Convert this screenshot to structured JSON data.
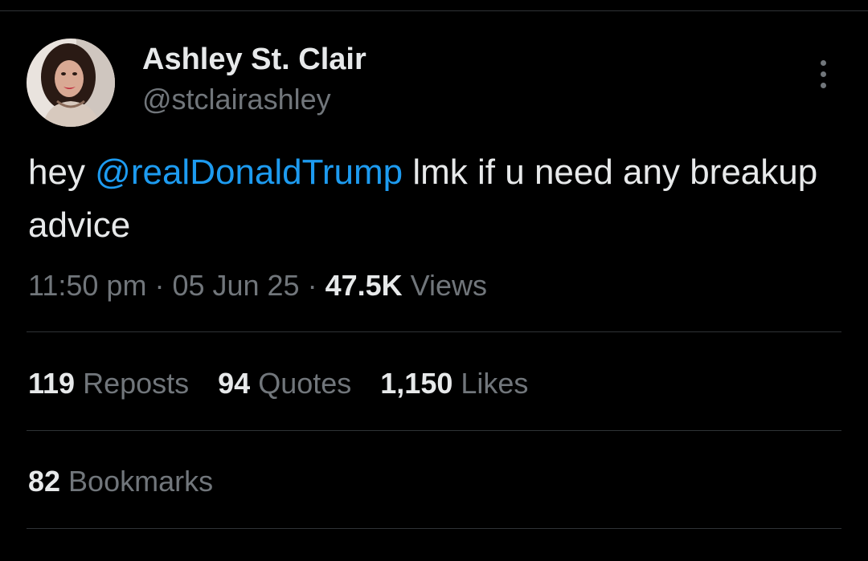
{
  "author": {
    "display_name": "Ashley St. Clair",
    "handle": "@stclairashley"
  },
  "tweet": {
    "text_before": "hey ",
    "mention": "@realDonaldTrump",
    "text_after": " lmk if u need any breakup advice"
  },
  "meta": {
    "time": "11:50 pm",
    "separator": " · ",
    "date": "05 Jun 25",
    "views_count": "47.5K",
    "views_label": " Views"
  },
  "stats": {
    "reposts_count": "119",
    "reposts_label": " Reposts",
    "quotes_count": "94",
    "quotes_label": " Quotes",
    "likes_count": "1,150",
    "likes_label": " Likes",
    "bookmarks_count": "82",
    "bookmarks_label": " Bookmarks"
  },
  "icons": {
    "more": "more-vertical-icon"
  },
  "colors": {
    "background": "#000000",
    "text_primary": "#e7e9ea",
    "text_secondary": "#71767b",
    "link": "#1d9bf0",
    "divider": "#2f3336"
  }
}
